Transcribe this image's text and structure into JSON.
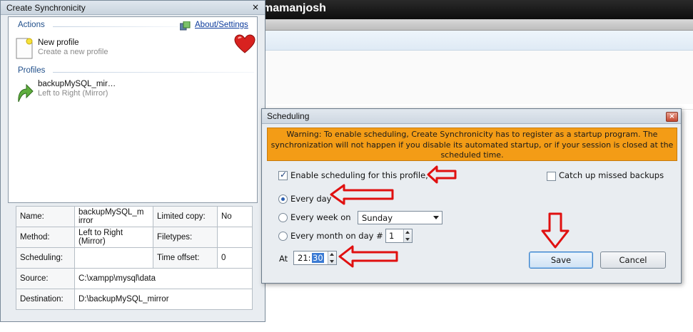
{
  "background_window": {
    "title": "mamanjosh"
  },
  "main_window": {
    "title": "Create Synchronicity",
    "close_glyph": "×",
    "actions_header": "Actions",
    "about_link": "About/Settings",
    "new_profile": {
      "title": "New profile",
      "subtitle": "Create a new profile"
    },
    "profiles_header": "Profiles",
    "profile": {
      "title": "backupMySQL_mir…",
      "subtitle": "Left to Right (Mirror)"
    },
    "details": {
      "name_label": "Name:",
      "name_value": "backupMySQL_m irror",
      "limited_copy_label": "Limited copy:",
      "limited_copy_value": "No",
      "method_label": "Method:",
      "method_value": "Left to Right (Mirror)",
      "filetypes_label": "Filetypes:",
      "filetypes_value": "",
      "scheduling_label": "Scheduling:",
      "scheduling_value": "",
      "time_offset_label": "Time offset:",
      "time_offset_value": "0",
      "source_label": "Source:",
      "source_value": "C:\\xampp\\mysql\\data",
      "destination_label": "Destination:",
      "destination_value": "D:\\backupMySQL_mirror"
    }
  },
  "scheduling_dialog": {
    "title": "Scheduling",
    "close_glyph": "×",
    "warning": "Warning: To enable scheduling, Create Synchronicity has to register as a startup program. The synchronization will not happen if you disable its automated startup, or if your session is closed at the scheduled time.",
    "enable_label": "Enable scheduling for this profile,",
    "enable_checked": true,
    "catchup_label": "Catch up missed backups",
    "catchup_checked": false,
    "every_day_label": "Every day",
    "every_week_label": "Every week on",
    "week_day_value": "Sunday",
    "every_month_label": "Every month on day #",
    "month_day_value": "1",
    "at_label": "At",
    "time_hour": "21:",
    "time_minute": "30",
    "save_label": "Save",
    "cancel_label": "Cancel"
  },
  "colors": {
    "warning_bg": "#f39c16",
    "annotation_arrow": "#e01010",
    "link": "#0b3a9c",
    "group_header": "#1f4e8a"
  }
}
